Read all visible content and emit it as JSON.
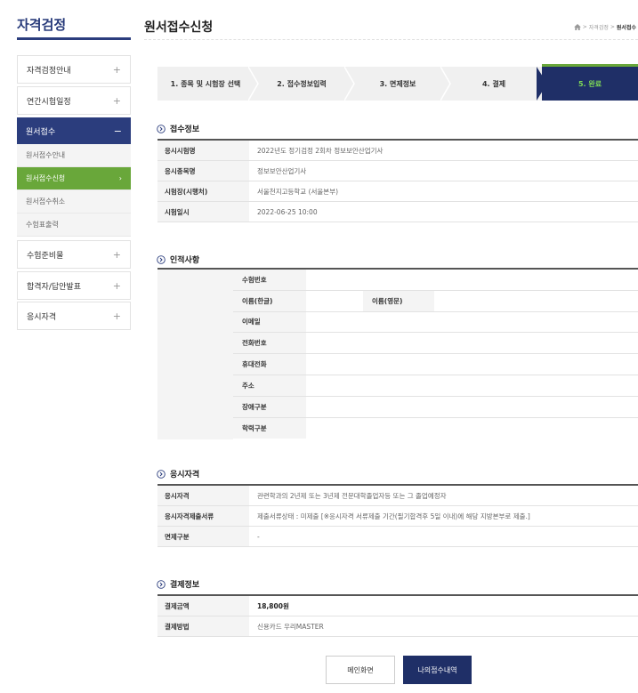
{
  "sidebar": {
    "title": "자격검정",
    "menus": [
      {
        "label": "자격검정안내",
        "icon": "+"
      },
      {
        "label": "연간시험일정",
        "icon": "+"
      }
    ],
    "active_menu": {
      "label": "원서접수",
      "icon": "−",
      "sub_items": [
        {
          "label": "원서접수안내"
        },
        {
          "label": "원서접수신청",
          "icon": "›"
        },
        {
          "label": "원서접수취소"
        },
        {
          "label": "수험표출력"
        }
      ]
    },
    "menus_after": [
      {
        "label": "수험준비물",
        "icon": "+"
      },
      {
        "label": "합격자/답안발표",
        "icon": "+"
      },
      {
        "label": "응시자격",
        "icon": "+"
      }
    ]
  },
  "header": {
    "title": "원서접수신청",
    "breadcrumb": [
      "자격검정",
      "원서접수"
    ],
    "breadcrumb_sep": ">"
  },
  "steps": [
    "1. 종목 및 시험장 선택",
    "2. 접수정보입력",
    "3. 면제정보",
    "4. 결제",
    "5. 완료"
  ],
  "receipt": {
    "title": "접수정보",
    "rows": [
      {
        "label": "응시시험명",
        "value": "2022년도 정기검정 2회차 정보보안산업기사"
      },
      {
        "label": "응시종목명",
        "value": "정보보안산업기사"
      },
      {
        "label": "시험장(시행처)",
        "value": "서울천지고등학교 (서울본부)"
      },
      {
        "label": "시험일시",
        "value": "2022-06-25 10:00"
      }
    ]
  },
  "personal": {
    "title": "인적사항",
    "rows": [
      "수험번호",
      "이름(한글)",
      "이메일",
      "전화번호",
      "휴대전화",
      "주소",
      "장애구분",
      "학력구분"
    ],
    "name_en_label": "이름(영문)"
  },
  "eligibility": {
    "title": "응시자격",
    "rows": [
      {
        "label": "응시자격",
        "value": "관련학과의 2년제 또는 3년제 전문대학졸업자등 또는 그 졸업예정자"
      },
      {
        "label": "응시자격제출서류",
        "value": "제출서류상태 : 미제출 [※응시자격 서류제출 기간(필기합격후 5일 이내)에 해당 지방본부로 제출.]"
      },
      {
        "label": "면제구분",
        "value": "-"
      }
    ]
  },
  "payment": {
    "title": "결제정보",
    "rows": [
      {
        "label": "결제금액",
        "value": "18,800원"
      },
      {
        "label": "결제방법",
        "value": "신용카드 우리MASTER"
      }
    ]
  },
  "buttons": {
    "main": "메인화면",
    "my_apps": "나의접수내역"
  },
  "colors": {
    "navy": "#1f2f67",
    "green": "#69a73a",
    "step_done_text": "#7ed957"
  }
}
